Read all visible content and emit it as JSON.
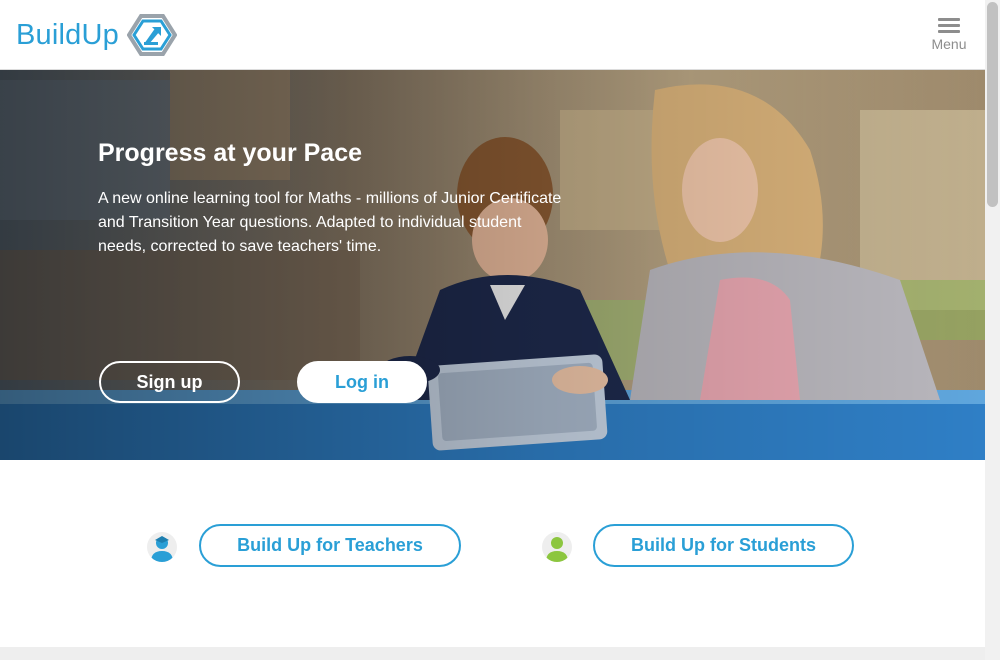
{
  "header": {
    "logo_text": "BuildUp",
    "menu_label": "Menu",
    "menu_icon": "hamburger-icon"
  },
  "hero": {
    "title": "Progress at your Pace",
    "description": "A new online learning tool for Maths - millions of Junior Certificate and Transition Year questions. Adapted to individual student needs, corrected to save teachers' time.",
    "signup_label": "Sign up",
    "login_label": "Log in",
    "image": "teacher-and-student-with-tablet-photo"
  },
  "audience": {
    "teachers_label": "Build Up for Teachers",
    "teachers_icon": "teacher-avatar-icon",
    "students_label": "Build Up for Students",
    "students_icon": "student-avatar-icon"
  },
  "colors": {
    "brand": "#2a9fd6",
    "teacher_icon": "#2a9fd6",
    "student_icon": "#8cc63f",
    "menu_gray": "#8d8d8d"
  }
}
